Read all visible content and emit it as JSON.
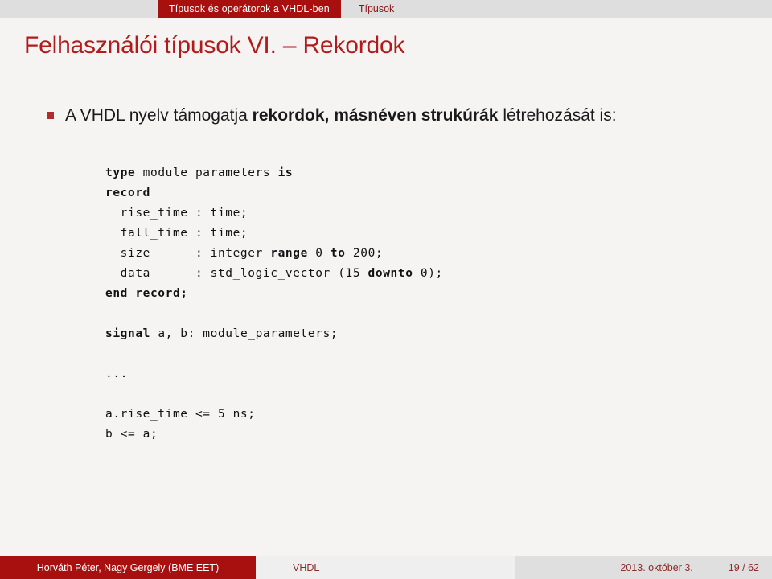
{
  "topbar": {
    "section_active": "Típusok és operátorok a VHDL-ben",
    "subsection": "Típusok"
  },
  "slide": {
    "title": "Felhasználói típusok VI. – Rekordok",
    "bullet": {
      "marker": "square-bullet",
      "text_before": "A VHDL nyelv támogatja ",
      "text_bold": "rekordok, másnéven strukúrák",
      "text_after": " létrehozását is:"
    },
    "code": [
      {
        "segments": [
          {
            "t": "type",
            "b": true
          },
          {
            "t": " module_parameters ",
            "b": false
          },
          {
            "t": "is",
            "b": true
          }
        ]
      },
      {
        "segments": [
          {
            "t": "record",
            "b": true
          }
        ]
      },
      {
        "segments": [
          {
            "t": "  rise_time : time;",
            "b": false
          }
        ]
      },
      {
        "segments": [
          {
            "t": "  fall_time : time;",
            "b": false
          }
        ]
      },
      {
        "segments": [
          {
            "t": "  size      : integer ",
            "b": false
          },
          {
            "t": "range",
            "b": true
          },
          {
            "t": " 0 ",
            "b": false
          },
          {
            "t": "to",
            "b": true
          },
          {
            "t": " 200;",
            "b": false
          }
        ]
      },
      {
        "segments": [
          {
            "t": "  data      : std_logic_vector (15 ",
            "b": false
          },
          {
            "t": "downto",
            "b": true
          },
          {
            "t": " 0);",
            "b": false
          }
        ]
      },
      {
        "segments": [
          {
            "t": "end record;",
            "b": true
          }
        ]
      },
      {
        "segments": []
      },
      {
        "segments": [
          {
            "t": "signal",
            "b": true
          },
          {
            "t": " a, b: module_parameters;",
            "b": false
          }
        ]
      },
      {
        "segments": []
      },
      {
        "segments": [
          {
            "t": "...",
            "b": false
          }
        ]
      },
      {
        "segments": []
      },
      {
        "segments": [
          {
            "t": "a.rise_time <= 5 ns;",
            "b": false
          }
        ]
      },
      {
        "segments": [
          {
            "t": "b <= a;",
            "b": false
          }
        ]
      }
    ]
  },
  "footer": {
    "authors": "Horváth Péter, Nagy Gergely  (BME EET)",
    "course": "VHDL",
    "date": "2013. október 3.",
    "page": "19 / 62"
  },
  "colors": {
    "brand_red": "#a80f0f",
    "title_red": "#b01c1c",
    "bullet_red": "#b02d2d",
    "topbar_gray": "#dedede",
    "page_bg": "#f5f4f3",
    "footer_mid_gray": "#efefef",
    "footer_right_gray": "#dfdfdf",
    "footer_link_red": "#8a2b2b"
  }
}
